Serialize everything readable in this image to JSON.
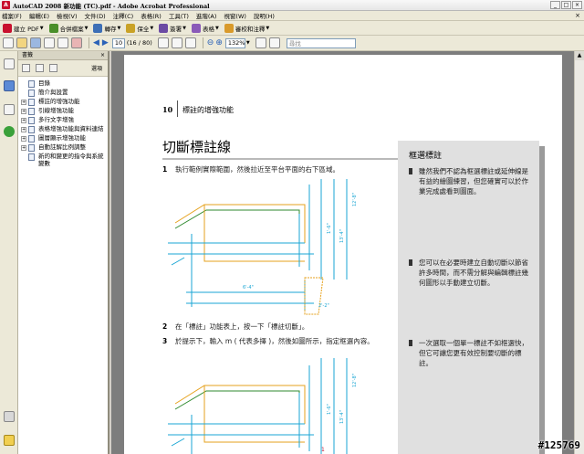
{
  "window": {
    "title": "AutoCAD 2008 新功能 (TC).pdf - Adobe Acrobat Professional",
    "app_icon": "acrobat-icon",
    "buttons": [
      "_",
      "□",
      "×"
    ]
  },
  "menu": {
    "items": [
      "檔案(F)",
      "編輯(E)",
      "檢視(V)",
      "文件(D)",
      "注釋(C)",
      "表格(R)",
      "工具(T)",
      "進階(A)",
      "視窗(W)",
      "說明(H)"
    ],
    "close": "×"
  },
  "toolbar1": {
    "buttons": [
      {
        "label": "建立 PDF",
        "icon": "create-pdf-icon",
        "color": "#c8102e"
      },
      {
        "label": "合併檔案",
        "icon": "combine-files-icon",
        "color": "#4a8f2a"
      },
      {
        "label": "轉存",
        "icon": "export-icon",
        "color": "#3d6fb6"
      },
      {
        "label": "保全",
        "icon": "lock-icon",
        "color": "#c9a227"
      },
      {
        "label": "簽署",
        "icon": "pen-icon",
        "color": "#6b4aa3"
      },
      {
        "label": "表格",
        "icon": "form-icon",
        "color": "#8a5ab8"
      },
      {
        "label": "審校和注釋",
        "icon": "review-icon",
        "color": "#d99a2b"
      }
    ]
  },
  "toolbar2": {
    "page_current": "10",
    "page_count": "(16 / 80)",
    "zoom": "132%",
    "search_placeholder": "尋找"
  },
  "bookmarks": {
    "header": "書籤",
    "options": "選項",
    "items": [
      {
        "label": "目錄",
        "expandable": false
      },
      {
        "label": "簡介與設置",
        "expandable": false
      },
      {
        "label": "標註的增強功能",
        "expandable": true
      },
      {
        "label": "引線增強功能",
        "expandable": true
      },
      {
        "label": "多行文字增強",
        "expandable": true
      },
      {
        "label": "表格增強功能與資料連結",
        "expandable": true
      },
      {
        "label": "圖層顯示增強功能",
        "expandable": true
      },
      {
        "label": "自動註解比例調整",
        "expandable": true
      },
      {
        "label": "新的和變更的指令與系統變數",
        "expandable": false
      }
    ]
  },
  "page": {
    "page_number": "10",
    "header_title": "標註的增強功能",
    "chapter_title": "切斷標註線",
    "steps": [
      {
        "num": "1",
        "text": "執行範例實際範圍，然後拉近至平台平面的右下區域。"
      },
      {
        "num": "2",
        "text": "在「標註」功能表上，按一下「標註切斷」。"
      },
      {
        "num": "3",
        "text": "於提示下，輸入 m ( 代表多擇 )，然後如圖所示，指定框選內容。"
      }
    ],
    "side_title": "框選標註",
    "side_items": [
      "雖然我們不認為框選標註或延伸線是有益的繪圖練習，但您確實可以於作業完成處看到圖面。",
      "您可以在必要時建立自動切斷以節省許多時間，而不需分解與編輯標註幾何圖形以手動建立切斷。",
      "一次選取一個單一標註不如框選快，但它可讓您更有效控制要切斷的標註。"
    ]
  },
  "drawing_labels": {
    "d1": "6'-4\"",
    "d2": "1'-6\"",
    "d3": "13'-4\"",
    "d4": "12'-8\"",
    "d5": "2'-2\"",
    "marker": "1"
  },
  "colors": {
    "orange": "#e6a21e",
    "green": "#2f8a2f",
    "cyan": "#1aa6d4",
    "gray_box": "#e0e0e0"
  },
  "watermark": "#125769"
}
